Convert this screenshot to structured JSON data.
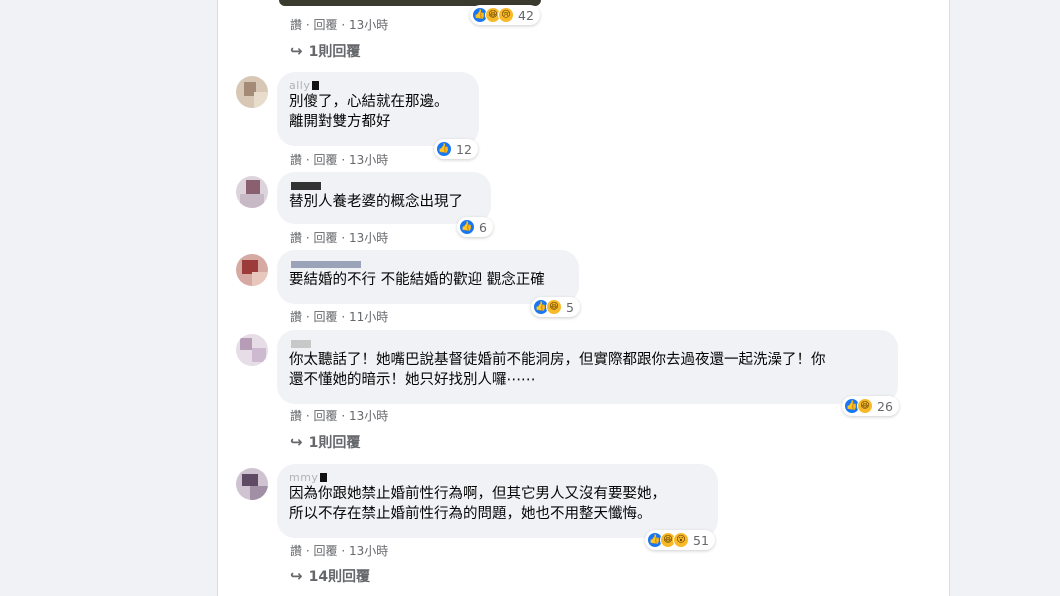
{
  "top": {
    "meta": {
      "like": "讚",
      "dot": "·",
      "reply": "回覆",
      "time": "13小時"
    },
    "reactions": {
      "count": "42",
      "icons": [
        "like-icon",
        "haha-icon",
        "sad-icon"
      ]
    },
    "replies": "1則回覆"
  },
  "comments": [
    {
      "author": "ally",
      "text": "別傻了，心結就在那邊。\n離開對雙方都好",
      "meta": {
        "like": "讚",
        "dot": "·",
        "reply": "回覆",
        "time": "13小時"
      },
      "reactions": {
        "count": "12",
        "icons": [
          "like-icon"
        ]
      }
    },
    {
      "author": "",
      "text": "替別人養老婆的概念出現了",
      "meta": {
        "like": "讚",
        "dot": "·",
        "reply": "回覆",
        "time": "13小時"
      },
      "reactions": {
        "count": "6",
        "icons": [
          "like-icon"
        ]
      }
    },
    {
      "author": "",
      "text": "要結婚的不行 不能結婚的歡迎 觀念正確",
      "meta": {
        "like": "讚",
        "dot": "·",
        "reply": "回覆",
        "time": "11小時"
      },
      "reactions": {
        "count": "5",
        "icons": [
          "like-icon",
          "haha-icon"
        ]
      }
    },
    {
      "author": "",
      "text": "你太聽話了！她嘴巴說基督徒婚前不能洞房，但實際都跟你去過夜還一起洗澡了！你\n還不懂她的暗示！她只好找別人囉⋯⋯",
      "meta": {
        "like": "讚",
        "dot": "·",
        "reply": "回覆",
        "time": "13小時"
      },
      "reactions": {
        "count": "26",
        "icons": [
          "like-icon",
          "haha-icon"
        ]
      },
      "replies": "1則回覆"
    },
    {
      "author": "mmy",
      "text": "因為你跟她禁止婚前性行為啊，但其它男人又沒有要娶她，\n所以不存在禁止婚前性行為的問題，她也不用整天懺悔。",
      "meta": {
        "like": "讚",
        "dot": "·",
        "reply": "回覆",
        "time": "13小時"
      },
      "reactions": {
        "count": "51",
        "icons": [
          "like-icon",
          "haha-icon",
          "wow-icon"
        ]
      },
      "replies": "14則回覆"
    }
  ],
  "colors": {
    "like": "#1877f2",
    "haha": "#f7b928",
    "bubble": "#f0f2f5",
    "meta": "#65676b"
  }
}
